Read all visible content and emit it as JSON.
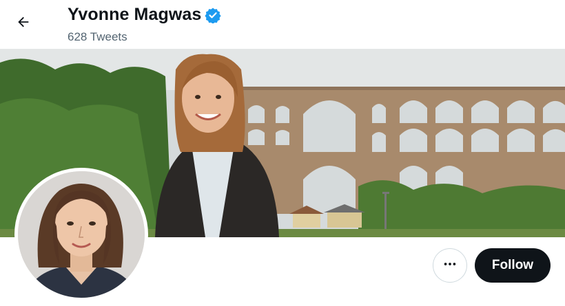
{
  "header": {
    "display_name": "Yvonne Magwas",
    "tweet_count": "628 Tweets",
    "verified": true,
    "back_icon": "arrow-left-icon",
    "verified_icon": "verified-badge-icon"
  },
  "actions": {
    "more_icon": "more-horizontal-icon",
    "follow_label": "Follow"
  },
  "colors": {
    "verified_blue": "#1d9bf0",
    "follow_bg": "#0f1419",
    "secondary_text": "#536471",
    "bridge_brick": "#a88a6c"
  }
}
